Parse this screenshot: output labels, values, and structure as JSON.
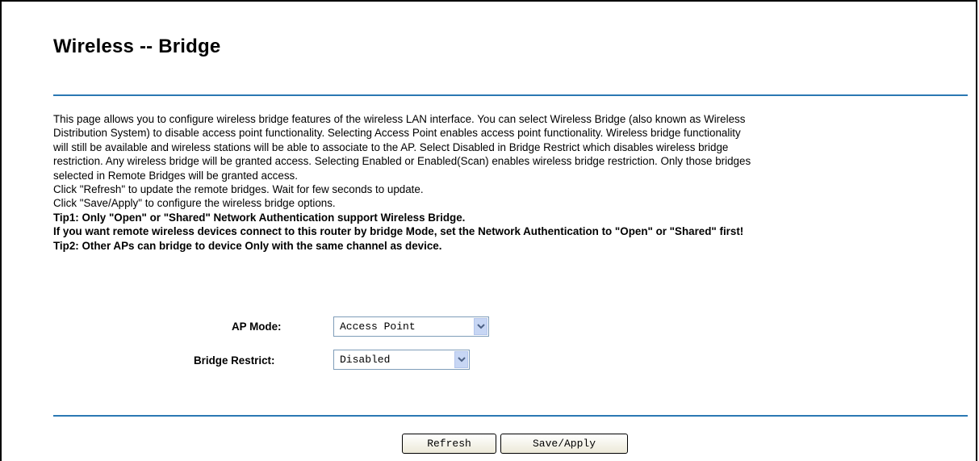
{
  "page": {
    "title": "Wireless -- Bridge"
  },
  "description": {
    "lines": [
      "This page allows you to configure wireless bridge features of the wireless LAN interface. You can select Wireless Bridge (also known as Wireless",
      "Distribution System) to disable access point functionality. Selecting Access Point enables access point functionality. Wireless bridge functionality",
      "will still be available and wireless stations will be able to associate to the AP. Select Disabled in Bridge Restrict which disables wireless bridge",
      "restriction. Any wireless bridge will be granted access. Selecting Enabled or Enabled(Scan) enables wireless bridge restriction. Only those bridges",
      "selected in Remote Bridges will be granted access.",
      "Click \"Refresh\" to update the remote bridges. Wait for few seconds to update.",
      "Click \"Save/Apply\" to configure the wireless bridge options."
    ],
    "tips": [
      "Tip1: Only \"Open\" or \"Shared\" Network Authentication support Wireless Bridge.",
      "If you want remote wireless devices connect to this router by bridge Mode, set the Network Authentication to \"Open\" or \"Shared\" first!",
      "Tip2: Other APs can bridge to device Only with the same channel as device."
    ]
  },
  "form": {
    "ap_mode": {
      "label": "AP Mode:",
      "value": "Access Point"
    },
    "bridge_restrict": {
      "label": "Bridge Restrict:",
      "value": "Disabled"
    }
  },
  "buttons": {
    "refresh": "Refresh",
    "save_apply": "Save/Apply"
  },
  "colors": {
    "rule": "#2b78b3",
    "dropdown_arrow_bg": "#c7d6f4",
    "dropdown_arrow": "#4d6185"
  },
  "icons": {
    "dropdown": "chevron-down-icon"
  }
}
